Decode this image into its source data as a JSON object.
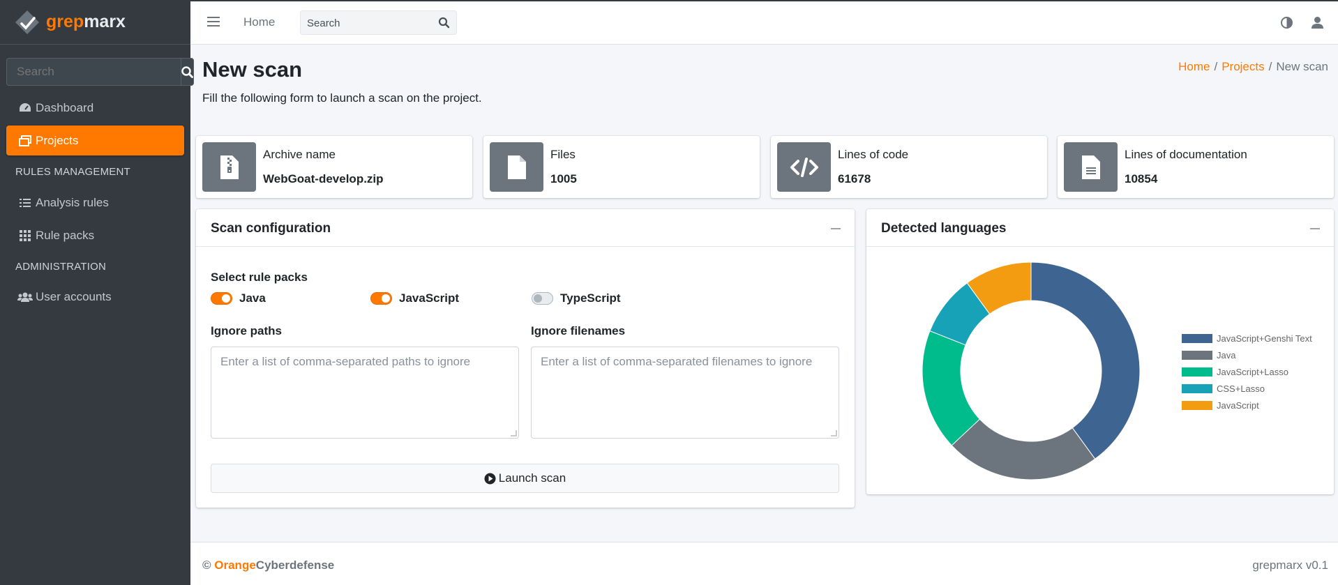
{
  "brand": {
    "part1": "grep",
    "part2": "marx"
  },
  "sidebar": {
    "search_placeholder": "Search",
    "items": [
      {
        "label": "Dashboard",
        "icon": "dashboard-icon"
      },
      {
        "label": "Projects",
        "icon": "projects-icon",
        "active": true
      },
      {
        "label": "Analysis rules",
        "icon": "list-icon"
      },
      {
        "label": "Rule packs",
        "icon": "grid-icon"
      },
      {
        "label": "User accounts",
        "icon": "users-icon"
      }
    ],
    "headers": [
      "RULES MANAGEMENT",
      "ADMINISTRATION"
    ]
  },
  "topbar": {
    "home": "Home",
    "search_placeholder": "Search"
  },
  "page": {
    "title": "New scan",
    "subtitle": "Fill the following form to launch a scan on the project.",
    "breadcrumb": [
      "Home",
      "Projects",
      "New scan"
    ]
  },
  "info_boxes": [
    {
      "label": "Archive name",
      "value": "WebGoat-develop.zip",
      "icon": "file-zip-icon"
    },
    {
      "label": "Files",
      "value": "1005",
      "icon": "file-icon"
    },
    {
      "label": "Lines of code",
      "value": "61678",
      "icon": "code-icon"
    },
    {
      "label": "Lines of documentation",
      "value": "10854",
      "icon": "file-text-icon"
    }
  ],
  "scan_config": {
    "title": "Scan configuration",
    "select_label": "Select rule packs",
    "packs": [
      {
        "label": "Java",
        "checked": true
      },
      {
        "label": "JavaScript",
        "checked": true
      },
      {
        "label": "TypeScript",
        "checked": false
      }
    ],
    "ignore_paths_label": "Ignore paths",
    "ignore_paths_placeholder": "Enter a list of comma-separated paths to ignore",
    "ignore_filenames_label": "Ignore filenames",
    "ignore_filenames_placeholder": "Enter a list of comma-separated filenames to ignore",
    "launch_label": "Launch scan"
  },
  "languages_card": {
    "title": "Detected languages"
  },
  "chart_data": {
    "type": "pie",
    "donut": true,
    "categories": [
      "JavaScript+Genshi Text",
      "Java",
      "JavaScript+Lasso",
      "CSS+Lasso",
      "JavaScript"
    ],
    "values": [
      40,
      23,
      18,
      9,
      10
    ],
    "colors": [
      "#3e6591",
      "#6c757d",
      "#00bc8c",
      "#17a2b8",
      "#f39c12"
    ],
    "legend_position": "right"
  },
  "colors": {
    "accent": "#ff7900",
    "sidebar": "#343a40"
  },
  "footer": {
    "copyright": "©",
    "brand_orange": "Orange",
    "brand_rest": "Cyberdefense",
    "version": "grepmarx v0.1"
  }
}
